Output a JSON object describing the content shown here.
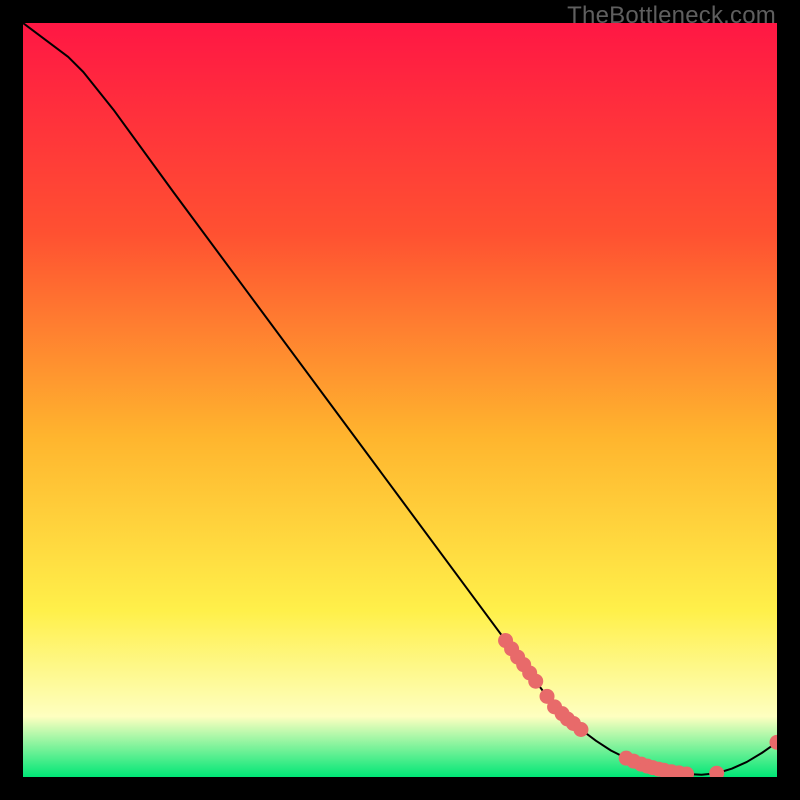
{
  "watermark": "TheBottleneck.com",
  "colors": {
    "gradient_top": "#ff1744",
    "gradient_upper": "#ff5131",
    "gradient_mid": "#ffb52e",
    "gradient_lower": "#fff04a",
    "gradient_pale": "#feffc0",
    "gradient_bottom": "#00e676",
    "line": "#000000",
    "marker": "#e86a6a",
    "frame": "#000000"
  },
  "chart_data": {
    "type": "line",
    "title": "",
    "xlabel": "",
    "ylabel": "",
    "xlim": [
      0,
      100
    ],
    "ylim": [
      0,
      100
    ],
    "series": [
      {
        "name": "bottleneck-curve",
        "x": [
          0,
          6,
          8,
          10,
          12,
          20,
          30,
          40,
          50,
          60,
          68,
          70,
          72,
          74,
          76,
          78,
          80,
          82,
          84,
          86,
          88,
          90,
          92,
          94,
          96,
          98,
          100
        ],
        "y": [
          100,
          95.5,
          93.5,
          91,
          88.5,
          77.5,
          64,
          50.5,
          37,
          23.5,
          12.7,
          10,
          8,
          6.3,
          4.8,
          3.5,
          2.5,
          1.7,
          1.1,
          0.7,
          0.4,
          0.3,
          0.5,
          1.1,
          2.0,
          3.2,
          4.6
        ]
      }
    ],
    "markers": {
      "name": "highlighted-points",
      "points": [
        {
          "x": 64.0,
          "y": 18.1
        },
        {
          "x": 64.8,
          "y": 17.0
        },
        {
          "x": 65.6,
          "y": 15.9
        },
        {
          "x": 66.4,
          "y": 14.9
        },
        {
          "x": 67.2,
          "y": 13.8
        },
        {
          "x": 68.0,
          "y": 12.7
        },
        {
          "x": 69.5,
          "y": 10.7
        },
        {
          "x": 70.5,
          "y": 9.3
        },
        {
          "x": 71.5,
          "y": 8.4
        },
        {
          "x": 72.2,
          "y": 7.7
        },
        {
          "x": 73.0,
          "y": 7.1
        },
        {
          "x": 74.0,
          "y": 6.3
        },
        {
          "x": 80.0,
          "y": 2.5
        },
        {
          "x": 81.0,
          "y": 2.1
        },
        {
          "x": 82.0,
          "y": 1.7
        },
        {
          "x": 82.8,
          "y": 1.45
        },
        {
          "x": 83.5,
          "y": 1.25
        },
        {
          "x": 84.3,
          "y": 1.05
        },
        {
          "x": 85.0,
          "y": 0.9
        },
        {
          "x": 86.0,
          "y": 0.7
        },
        {
          "x": 87.0,
          "y": 0.55
        },
        {
          "x": 88.0,
          "y": 0.4
        },
        {
          "x": 92.0,
          "y": 0.5
        },
        {
          "x": 100.0,
          "y": 4.6
        }
      ]
    }
  }
}
